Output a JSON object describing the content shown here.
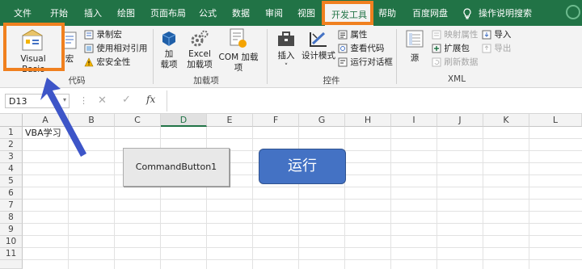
{
  "tabs": {
    "file": "文件",
    "home": "开始",
    "insert": "插入",
    "draw": "绘图",
    "layout": "页面布局",
    "formulas": "公式",
    "data": "数据",
    "review": "审阅",
    "view": "视图",
    "developer": "开发工具",
    "help": "帮助",
    "baidu": "百度网盘",
    "tellme": "操作说明搜索"
  },
  "ribbon": {
    "code": {
      "visual_basic": "Visual Basic",
      "macros": "宏",
      "record_macro": "录制宏",
      "relative_refs": "使用相对引用",
      "macro_security": "宏安全性",
      "group": "代码"
    },
    "addins": {
      "addins_l1": "加",
      "addins_l2": "载项",
      "excel_l1": "Excel",
      "excel_l2": "加载项",
      "com": "COM 加载项",
      "group": "加载项"
    },
    "controls": {
      "insert": "插入",
      "design_mode": "设计模式",
      "properties": "属性",
      "view_code": "查看代码",
      "run_dialog": "运行对话框",
      "group": "控件"
    },
    "xml": {
      "source": "源",
      "map_props": "映射属性",
      "expansion": "扩展包",
      "refresh": "刷新数据",
      "import": "导入",
      "export": "导出",
      "group": "XML"
    }
  },
  "formula_bar": {
    "name_box": "D13",
    "fx": "fx",
    "value": ""
  },
  "grid": {
    "columns": [
      "A",
      "B",
      "C",
      "D",
      "E",
      "F",
      "G",
      "H",
      "I",
      "J",
      "K",
      "L"
    ],
    "rows": [
      "1",
      "2",
      "3",
      "4",
      "5",
      "6",
      "7",
      "8",
      "9",
      "10",
      "11"
    ],
    "selected_column": "D",
    "cell_a1": "VBA学习"
  },
  "buttons": {
    "command_button": "CommandButton1",
    "run_button": "运行"
  },
  "colors": {
    "excel_green": "#217346",
    "highlight_orange": "#f0801f",
    "arrow_blue": "#3d55c8",
    "run_blue": "#4472c4"
  }
}
